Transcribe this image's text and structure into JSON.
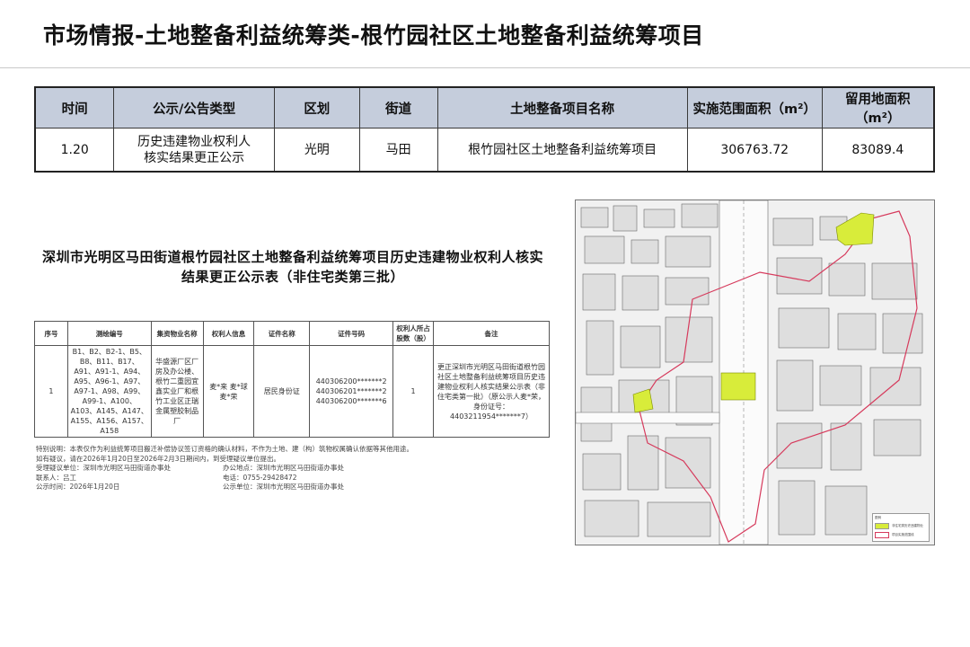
{
  "title": "市场情报-土地整备利益统筹类-根竹园社区土地整备利益统筹项目",
  "summary_table": {
    "headers": [
      "时间",
      "公示/公告类型",
      "区划",
      "街道",
      "土地整备项目名称",
      "实施范围面积（m²）",
      "留用地面积（m²）"
    ],
    "row": {
      "time": "1.20",
      "type_line1": "历史违建物业权利人",
      "type_line2": "核实结果更正公示",
      "district": "光明",
      "street": "马田",
      "project": "根竹园社区土地整备利益统筹项目",
      "area": "306763.72",
      "reserved_area": "83089.4"
    }
  },
  "notice": {
    "title_line1": "深圳市光明区马田街道根竹园社区土地整备利益统筹项目历史违建物业权利人核实",
    "title_line2": "结果更正公示表（非住宅类第三批）",
    "headers": [
      "序号",
      "测绘编号",
      "集资物业名称",
      "权利人信息",
      "证件名称",
      "证件号码",
      "权利人所占股数（股）",
      "备注"
    ],
    "row": {
      "index": "1",
      "survey_ids": "B1、B2、B2-1、B5、B8、B11、B17、A91、A91-1、A94、A95、A96-1、A97、A97-1、A98、A99、A99-1、A100、A103、A145、A147、A155、A156、A157、A158",
      "property": "华盛源厂区厂房及办公楼、根竹二重园宜鑫实业厂和根竹工业区正瑞金属塑胶制品厂",
      "owners": "麦*来 麦*球 麦*荣",
      "id_type": "居民身份证",
      "id_numbers": "440306200*******2 440306201*******2 440306200*******6",
      "shares": "1",
      "remark": "更正深圳市光明区马田街道根竹园社区土地整备利益统筹项目历史违建物业权利人核实结果公示表（非住宅类第一批）（原公示人麦*荣，身份证号：4403211954*******7）"
    },
    "notes": {
      "line1": "特别说明：本表仅作为利益统筹项目搬迁补偿协议签订资格的确认材料，不作为土地、建（构）筑物权属确认依据等其他用途。",
      "line2": "如有疑议，请在2026年1月20日至2026年2月3日期间内，到受理疑议单位提出。",
      "accept_unit": "受理疑议单位：深圳市光明区马田街道办事处",
      "office_addr": "办公地点：深圳市光明区马田街道办事处",
      "contact": "联系人：吕工",
      "phone": "电话：0755-29428472",
      "time": "公示时间：2026年1月20日",
      "publisher": "公示单位：深圳市光明区马田街道办事处"
    }
  },
  "map": {
    "legend_title": "图例",
    "legend_item1": "非住宅类历史违建物业",
    "legend_item2": "项目实施范围线",
    "colors": {
      "highlight": "#d8ec3a",
      "boundary": "#d63a5c",
      "road": "#ffffff",
      "block": "#e2e2e2"
    }
  }
}
